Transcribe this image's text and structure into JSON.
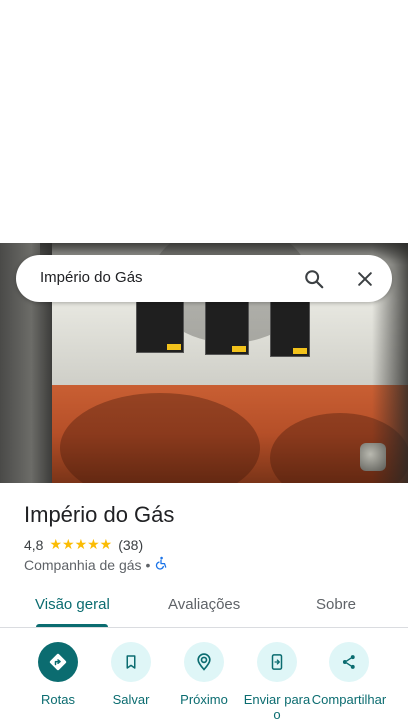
{
  "search": {
    "query": "Império do Gás"
  },
  "place": {
    "name": "Império do Gás",
    "rating": "4,8",
    "stars": "★★★★★",
    "reviews": "(38)",
    "category": "Companhia de gás",
    "separator": "•"
  },
  "tabs": [
    {
      "label": "Visão geral",
      "active": true
    },
    {
      "label": "Avaliações",
      "active": false
    },
    {
      "label": "Sobre",
      "active": false
    }
  ],
  "actions": [
    {
      "label": "Rotas",
      "icon": "directions-icon"
    },
    {
      "label": "Salvar",
      "icon": "bookmark-icon"
    },
    {
      "label": "Próximo",
      "icon": "nearby-icon"
    },
    {
      "label": "Enviar para o",
      "icon": "send-to-phone-icon"
    },
    {
      "label": "Compartilhar",
      "icon": "share-icon"
    }
  ],
  "colors": {
    "accent": "#0b6c70",
    "accent_light": "#dff6f7",
    "star": "#fbbc04"
  }
}
